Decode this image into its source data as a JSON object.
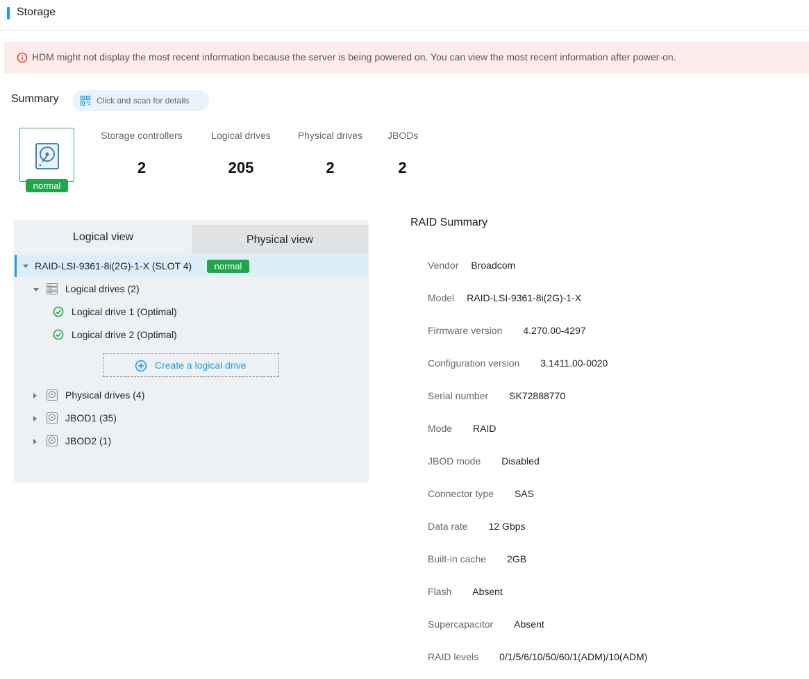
{
  "header": {
    "title": "Storage"
  },
  "alert": {
    "text": "HDM might not display the most recent information because the server is being powered on. You can view the most recent information after power-on."
  },
  "summary": {
    "title": "Summary",
    "scan_label": "Click and scan for details",
    "status": "normal",
    "stats": [
      {
        "label": "Storage controllers",
        "value": "2"
      },
      {
        "label": "Logical drives",
        "value": "205"
      },
      {
        "label": "Physical drives",
        "value": "2"
      },
      {
        "label": "JBODs",
        "value": "2"
      }
    ]
  },
  "tabs": {
    "logical": "Logical view",
    "physical": "Physical view"
  },
  "tree": {
    "controller": {
      "label": "RAID-LSI-9361-8i(2G)-1-X (SLOT 4)",
      "status": "normal"
    },
    "logical_drives": {
      "label": "Logical drives (2)"
    },
    "drives": [
      {
        "label": "Logical drive 1 (Optimal)"
      },
      {
        "label": "Logical drive 2 (Optimal)"
      }
    ],
    "create_label": "Create a logical drive",
    "physical_drives": {
      "label": "Physical drives (4)"
    },
    "jbod1": {
      "label": "JBOD1 (35)"
    },
    "jbod2": {
      "label": "JBOD2 (1)"
    }
  },
  "raid": {
    "title": "RAID Summary",
    "fields": [
      {
        "key": "Vendor",
        "value": "Broadcom"
      },
      {
        "key": "Model",
        "value": "RAID-LSI-9361-8i(2G)-1-X"
      },
      {
        "key": "Firmware version",
        "value": "4.270.00-4297"
      },
      {
        "key": "Configuration version",
        "value": "3.1411.00-0020"
      },
      {
        "key": "Serial number",
        "value": "SK72888770"
      },
      {
        "key": "Mode",
        "value": "RAID"
      },
      {
        "key": "JBOD mode",
        "value": "Disabled"
      },
      {
        "key": "Connector type",
        "value": "SAS"
      },
      {
        "key": "Data rate",
        "value": "12 Gbps"
      },
      {
        "key": "Built-in cache",
        "value": "2GB"
      },
      {
        "key": "Flash",
        "value": "Absent"
      },
      {
        "key": "Supercapacitor",
        "value": "Absent"
      },
      {
        "key": "RAID levels",
        "value": "0/1/5/6/10/50/60/1(ADM)/10(ADM)"
      }
    ]
  },
  "colors": {
    "accent": "#1a9de8",
    "ok": "#1fa84a",
    "alert_bg": "#fdecec",
    "alert_icon": "#e0463c"
  }
}
